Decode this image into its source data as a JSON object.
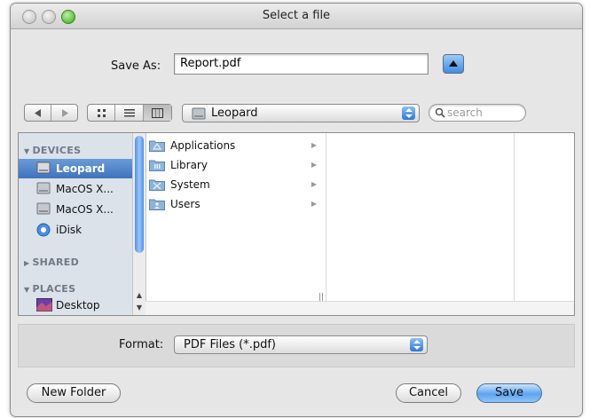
{
  "window": {
    "title": "Select a file"
  },
  "save_as": {
    "label": "Save As:",
    "value": "Report.pdf"
  },
  "toolbar": {
    "back_icon": "left-triangle-icon",
    "forward_icon": "right-triangle-icon",
    "view_icons": [
      "icon-view-icon",
      "list-view-icon",
      "column-view-icon"
    ],
    "location": "Leopard",
    "search_placeholder": "search"
  },
  "sidebar": {
    "devices_header": "DEVICES",
    "devices": [
      {
        "label": "Leopard",
        "icon": "hard-drive-icon"
      },
      {
        "label": "MacOS X...",
        "icon": "hard-drive-icon"
      },
      {
        "label": "MacOS X...",
        "icon": "hard-drive-icon"
      },
      {
        "label": "iDisk",
        "icon": "idisk-icon"
      }
    ],
    "shared_header": "SHARED",
    "places_header": "PLACES",
    "places": [
      {
        "label": "Desktop",
        "icon": "desktop-icon"
      }
    ]
  },
  "column1": [
    {
      "label": "Applications",
      "icon": "applications-folder-icon"
    },
    {
      "label": "Library",
      "icon": "library-folder-icon"
    },
    {
      "label": "System",
      "icon": "system-folder-icon"
    },
    {
      "label": "Users",
      "icon": "users-folder-icon"
    }
  ],
  "format": {
    "label": "Format:",
    "value": "PDF Files (*.pdf)"
  },
  "buttons": {
    "new_folder": "New Folder",
    "cancel": "Cancel",
    "save": "Save"
  },
  "colors": {
    "selection": "#3e73bd",
    "accent": "#2f78d8",
    "sidebar_bg": "#dbe2ea"
  }
}
